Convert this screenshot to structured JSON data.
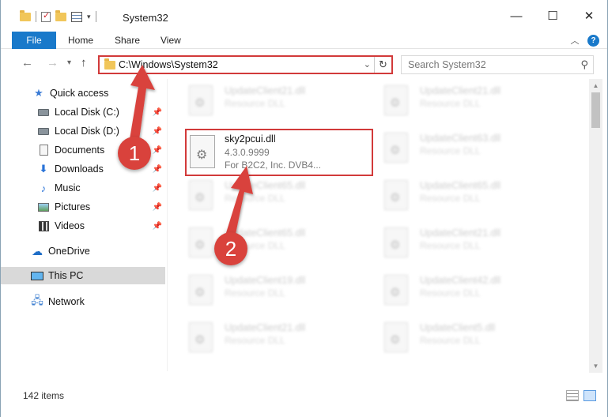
{
  "window": {
    "title": "System32",
    "qat_dropdown": "▾",
    "minimize": "—",
    "maximize": "☐",
    "close": "✕"
  },
  "ribbon": {
    "file": "File",
    "tabs": [
      "Home",
      "Share",
      "View"
    ],
    "collapse": "︿",
    "help": "?"
  },
  "nav": {
    "back": "←",
    "forward": "→",
    "recent": "▾",
    "up": "↑"
  },
  "address": {
    "path": "C:\\Windows\\System32",
    "dropdown": "⌄",
    "refresh": "↻"
  },
  "search": {
    "placeholder": "Search System32",
    "icon": "⚲"
  },
  "sidebar": {
    "items": [
      {
        "label": "Quick access",
        "icon": "star-icon"
      },
      {
        "label": "Local Disk (C:)",
        "icon": "disk-icon",
        "pinned": true
      },
      {
        "label": "Local Disk (D:)",
        "icon": "disk-icon",
        "pinned": true
      },
      {
        "label": "Documents",
        "icon": "document-icon",
        "pinned": true
      },
      {
        "label": "Downloads",
        "icon": "download-icon",
        "pinned": true
      },
      {
        "label": "Music",
        "icon": "music-icon",
        "pinned": true
      },
      {
        "label": "Pictures",
        "icon": "pictures-icon",
        "pinned": true
      },
      {
        "label": "Videos",
        "icon": "video-icon",
        "pinned": true
      },
      {
        "label": "OneDrive",
        "icon": "cloud-icon"
      },
      {
        "label": "This PC",
        "icon": "computer-icon",
        "selected": true
      },
      {
        "label": "Network",
        "icon": "network-icon"
      }
    ],
    "pin_glyph": "📌"
  },
  "files": {
    "left": [
      {
        "name": "UpdateClient21.dll",
        "type": "Resource DLL"
      },
      {
        "name": "UpdateClient65.dll",
        "type": "Resource DLL"
      },
      {
        "name": "UpdateClient65.dll",
        "type": "Resource DLL"
      },
      {
        "name": "UpdateClient19.dll",
        "type": "Resource DLL"
      },
      {
        "name": "UpdateClient21.dll",
        "type": "Resource DLL"
      }
    ],
    "right": [
      {
        "name": "UpdateClient21.dll",
        "type": "Resource DLL"
      },
      {
        "name": "UpdateClient63.dll",
        "type": "Resource DLL"
      },
      {
        "name": "UpdateClient65.dll",
        "type": "Resource DLL"
      },
      {
        "name": "UpdateClient21.dll",
        "type": "Resource DLL"
      },
      {
        "name": "UpdateClient42.dll",
        "type": "Resource DLL"
      },
      {
        "name": "UpdateClient5.dll",
        "type": "Resource DLL"
      }
    ],
    "highlighted": {
      "name": "sky2pcui.dll",
      "version": "4.3.0.9999",
      "company": "For B2C2, Inc. DVB4..."
    }
  },
  "status": {
    "count": "142 items"
  },
  "annotations": {
    "step1": "1",
    "step2": "2",
    "color": "#d9423c"
  }
}
